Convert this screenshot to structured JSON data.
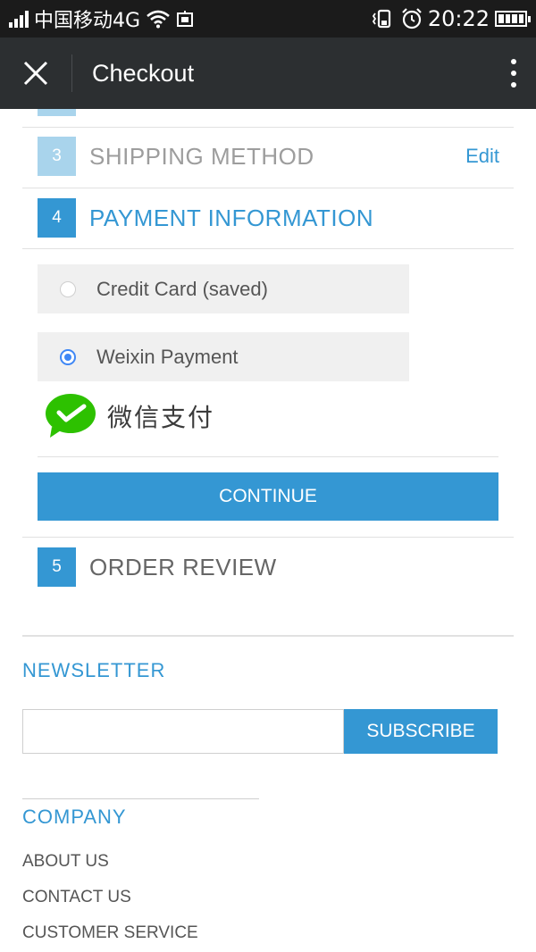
{
  "status_bar": {
    "carrier": "中国移动4G",
    "time": "20:22",
    "icons": [
      "signal-icon",
      "wifi-icon",
      "sim-icon",
      "vibrate-icon",
      "alarm-icon",
      "battery-icon"
    ]
  },
  "app_bar": {
    "title": "Checkout",
    "close_icon": "close-icon",
    "menu_icon": "more-vert-icon"
  },
  "steps": [
    {
      "number": "3",
      "title": "SHIPPING METHOD",
      "state": "completed",
      "edit_label": "Edit"
    },
    {
      "number": "4",
      "title": "PAYMENT INFORMATION",
      "state": "active"
    },
    {
      "number": "5",
      "title": "ORDER REVIEW",
      "state": "upcoming"
    }
  ],
  "payment": {
    "options": [
      {
        "label": "Credit Card (saved)",
        "checked": false
      },
      {
        "label": "Weixin Payment",
        "checked": true
      }
    ],
    "wechat_logo_text": "微信支付",
    "continue_label": "CONTINUE"
  },
  "newsletter": {
    "title": "NEWSLETTER",
    "input_value": "",
    "subscribe_label": "SUBSCRIBE"
  },
  "company": {
    "title": "COMPANY",
    "links": [
      "ABOUT US",
      "CONTACT US",
      "CUSTOMER SERVICE"
    ]
  },
  "colors": {
    "accent": "#3497d3",
    "accent_light": "#a9d4ec",
    "app_bar": "#2c2f31",
    "status_bar": "#1b1b1b",
    "wechat_green": "#2dc100"
  }
}
